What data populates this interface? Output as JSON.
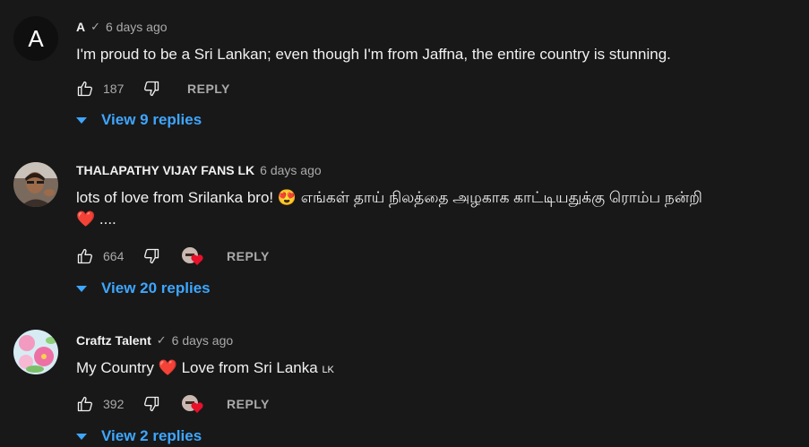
{
  "comments": [
    {
      "avatar_letter": "A",
      "author": "A",
      "verified": true,
      "time": "6 days ago",
      "text": "I'm proud to be a Sri Lankan; even though I'm from Jaffna, the entire country is stunning.",
      "likes": "187",
      "reply_label": "REPLY",
      "replies_label": "View 9 replies",
      "creator_heart": false
    },
    {
      "author": "THALAPATHY VIJAY FANS LK",
      "verified": false,
      "time": "6 days ago",
      "text_a": "lots of love from Srilanka bro! 😍 எங்கள் தாய் நிலத்தை அழகாக காட்டியதுக்கு ரொம்ப நன்றி",
      "text_b": "❤️ ....",
      "likes": "664",
      "reply_label": "REPLY",
      "replies_label": "View 20 replies",
      "creator_heart": true
    },
    {
      "author": "Craftz Talent",
      "verified": true,
      "time": "6 days ago",
      "text_a": "My Country",
      "text_heart": "❤️",
      "text_b": "Love from Sri Lanka",
      "flag": "LK",
      "likes": "392",
      "reply_label": "REPLY",
      "replies_label": "View 2 replies",
      "creator_heart": true
    }
  ],
  "colors": {
    "background": "#181818",
    "text": "#f1f1f1",
    "muted": "#aaaaaa",
    "link": "#3ea6ff",
    "heart": "#e8102a"
  },
  "icons": {
    "like": "thumb-up-icon",
    "dislike": "thumb-down-icon",
    "creator_heart": "creator-heart-icon",
    "verified": "check-icon",
    "expand": "caret-down-icon"
  }
}
